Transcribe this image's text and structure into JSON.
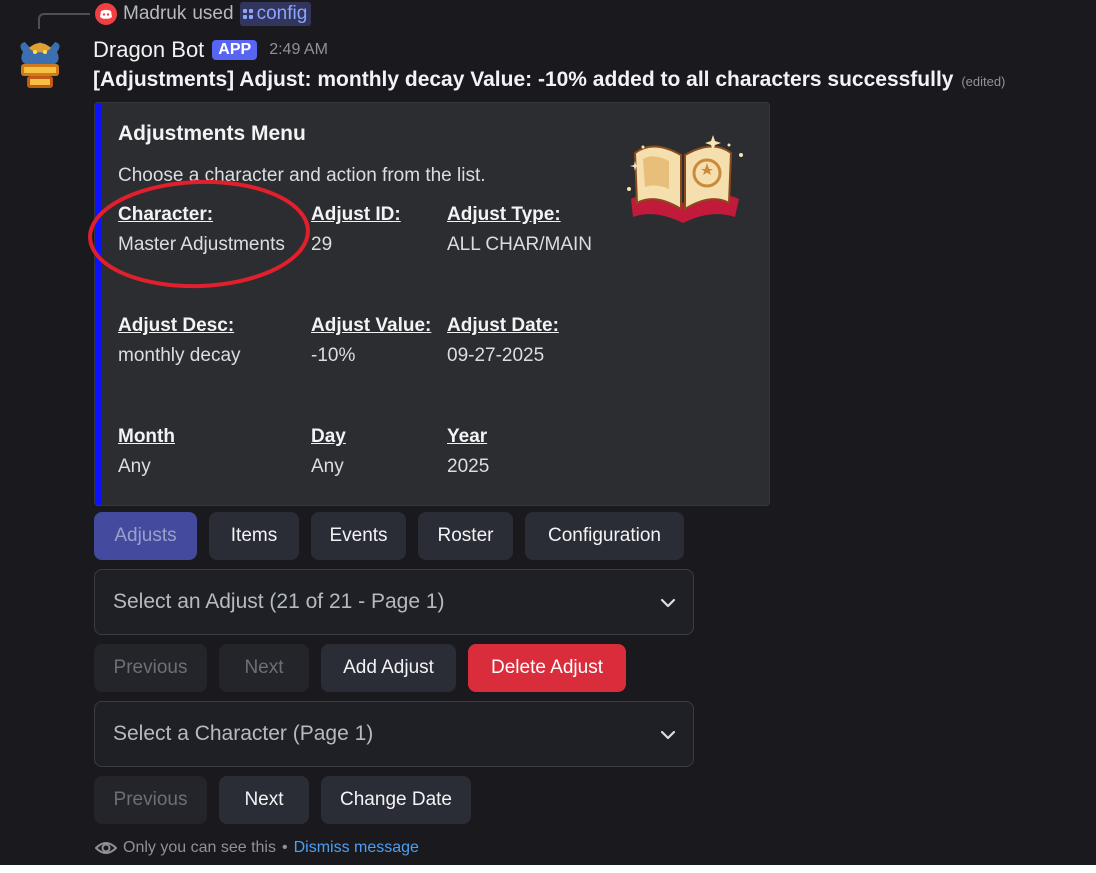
{
  "reply": {
    "user": "Madruk",
    "used": "used",
    "command": "config"
  },
  "header": {
    "bot_name": "Dragon Bot",
    "badge": "APP",
    "time": "2:49 AM"
  },
  "message": {
    "text": "[Adjustments] Adjust: monthly decay Value: -10% added to all characters successfully",
    "edited": "(edited)"
  },
  "embed": {
    "accent_color": "#0b12ff",
    "title": "Adjustments Menu",
    "description": "Choose a character and action from the list.",
    "fields": [
      {
        "name": "Character",
        "value": "Master Adjustments"
      },
      {
        "name": "Adjust ID",
        "value": "29"
      },
      {
        "name": "Adjust Type",
        "value": "ALL CHAR/MAIN"
      },
      {
        "name": "Adjust Desc",
        "value": "monthly decay"
      },
      {
        "name": "Adjust Value",
        "value": "-10%"
      },
      {
        "name": "Adjust Date",
        "value": "09-27-2025"
      },
      {
        "name": "Month",
        "value": "Any"
      },
      {
        "name": "Day",
        "value": "Any"
      },
      {
        "name": "Year",
        "value": "2025"
      }
    ],
    "field_suffix": ":"
  },
  "tabs": [
    "Adjusts",
    "Items",
    "Events",
    "Roster",
    "Configuration"
  ],
  "adjust_select": {
    "placeholder": "Select an Adjust (21 of 21 - Page 1)"
  },
  "adjust_buttons": {
    "previous": "Previous",
    "next": "Next",
    "add": "Add Adjust",
    "delete": "Delete Adjust"
  },
  "character_select": {
    "placeholder": "Select a Character (Page 1)"
  },
  "character_buttons": {
    "previous": "Previous",
    "next": "Next",
    "change_date": "Change Date"
  },
  "footer": {
    "notice": "Only you can see this",
    "separator": "•",
    "dismiss": "Dismiss message"
  },
  "colors": {
    "danger": "#da2d3c",
    "brand": "#5865f2",
    "link": "#4b9ff5",
    "annotation": "#e0202c"
  }
}
